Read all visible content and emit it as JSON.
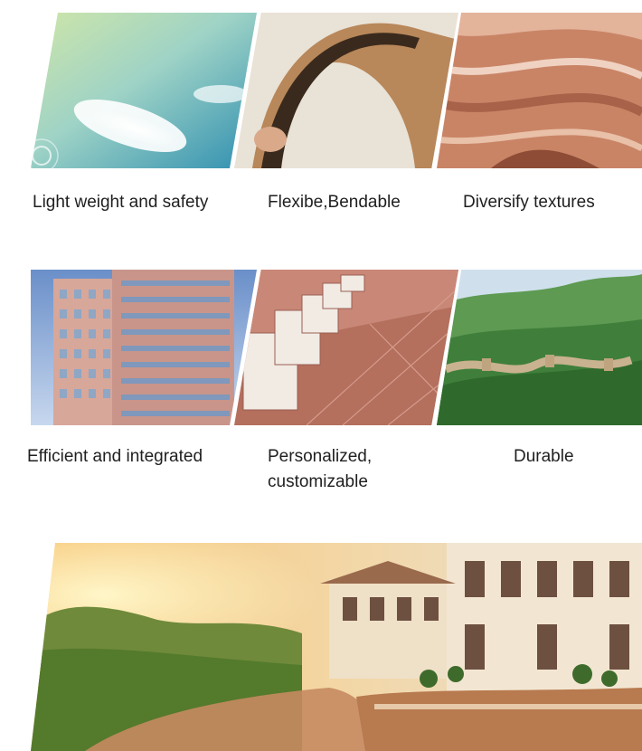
{
  "features": [
    {
      "caption": "Light weight and safety",
      "image": "feather-image"
    },
    {
      "caption": "Flexibe,Bendable",
      "image": "bent-veneer-image"
    },
    {
      "caption": "Diversify textures",
      "image": "sandstone-canyon-image"
    },
    {
      "caption": "Efficient and integrated",
      "image": "high-rise-building-image"
    },
    {
      "caption": "Personalized, customizable",
      "image": "terrace-tiles-image"
    },
    {
      "caption": "Durable",
      "image": "great-wall-image"
    }
  ],
  "banner": {
    "image": "villa-sunset-river-image"
  },
  "colors": {
    "background": "#ffffff",
    "text": "#1f1f1f"
  }
}
